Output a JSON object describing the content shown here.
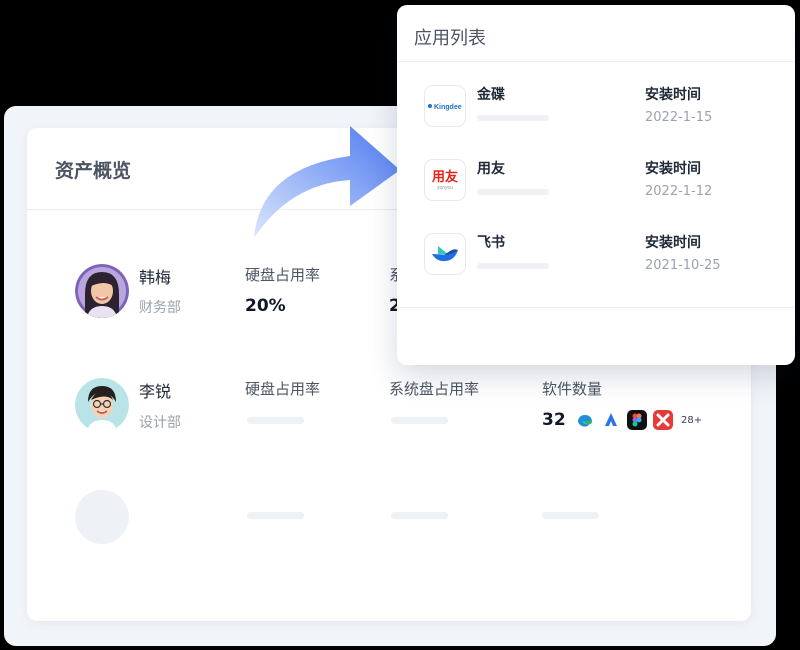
{
  "asset_overview": {
    "title": "资产概览",
    "columns": {
      "disk_usage": "硬盘占用率",
      "system_disk_usage": "系统盘占用率",
      "software_count": "软件数量"
    },
    "users": [
      {
        "name": "韩梅",
        "department": "财务部",
        "disk_usage": "20%",
        "system_disk_usage_partial": "2"
      },
      {
        "name": "李锐",
        "department": "设计部",
        "software_count": "32",
        "software_icons": [
          "edge-icon",
          "arrow-app-icon",
          "figma-icon",
          "xmind-icon"
        ],
        "software_more": "28+"
      }
    ]
  },
  "app_list": {
    "title": "应用列表",
    "apps": [
      {
        "name": "金碟",
        "logo_text": "Kingdee",
        "logo_icon": "kingdee-logo-icon",
        "install_label": "安装时间",
        "install_date": "2022-1-15"
      },
      {
        "name": "用友",
        "logo_text": "用友",
        "logo_subtext": "yonyou",
        "logo_icon": "yonyou-logo-icon",
        "install_label": "安装时间",
        "install_date": "2022-1-12"
      },
      {
        "name": "飞书",
        "logo_icon": "feishu-logo-icon",
        "install_label": "安装时间",
        "install_date": "2021-10-25"
      }
    ]
  },
  "colors": {
    "background": "#000000",
    "card": "#ffffff",
    "frame": "#f1f4f8",
    "arrow_top": "#4a78f0",
    "arrow_bottom": "#dbe6fc",
    "yonyou_red": "#e0261a",
    "feishu_blue": "#1f6fe0"
  }
}
